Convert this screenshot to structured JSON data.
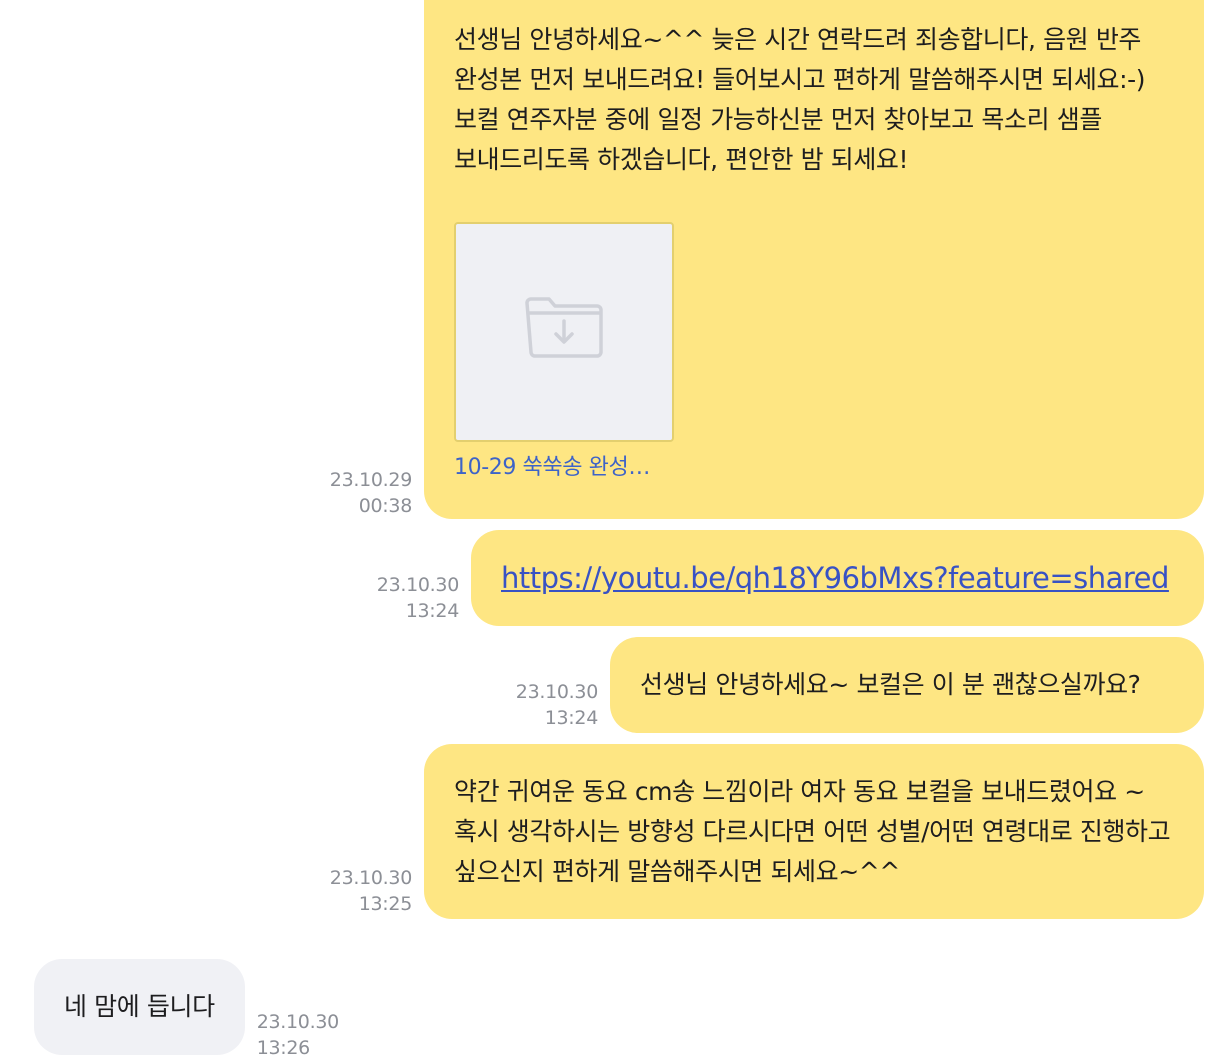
{
  "messages": [
    {
      "id": "m1",
      "date": "23.10.29",
      "time": "00:38",
      "text": "선생님 안녕하세요~^^ 늦은 시간 연락드려 죄송합니다, 음원 반주 완성본 먼저 보내드려요! 들어보시고 편하게 말씀해주시면 되세요:-) 보컬 연주자분 중에 일정 가능하신분 먼저 찾아보고 목소리 샘플 보내드리도록 하겠습니다, 편안한 밤 되세요!",
      "attachment": {
        "icon": "folder-download-icon",
        "name": "10-29 쑥쑥송 완성…"
      }
    },
    {
      "id": "m2",
      "date": "23.10.30",
      "time": "13:24",
      "link": "https://youtu.be/qh18Y96bMxs?feature=shared"
    },
    {
      "id": "m3",
      "date": "23.10.30",
      "time": "13:24",
      "text": "선생님 안녕하세요~ 보컬은 이 분 괜찮으실까요?"
    },
    {
      "id": "m4",
      "date": "23.10.30",
      "time": "13:25",
      "text": "약간 귀여운 동요 cm송 느낌이라 여자 동요 보컬을 보내드렸어요 ~ 혹시 생각하시는 방향성 다르시다면 어떤 성별/어떤 연령대로 진행하고 싶으신지 편하게 말씀해주시면 되세요~^^"
    },
    {
      "id": "m5",
      "date": "23.10.30",
      "time": "13:26",
      "text": "네 맘에 듭니다"
    }
  ],
  "colors": {
    "outgoing_bubble": "#fee683",
    "incoming_bubble": "#f0f1f5",
    "link": "#3852c4",
    "timestamp": "#8c8f96"
  }
}
